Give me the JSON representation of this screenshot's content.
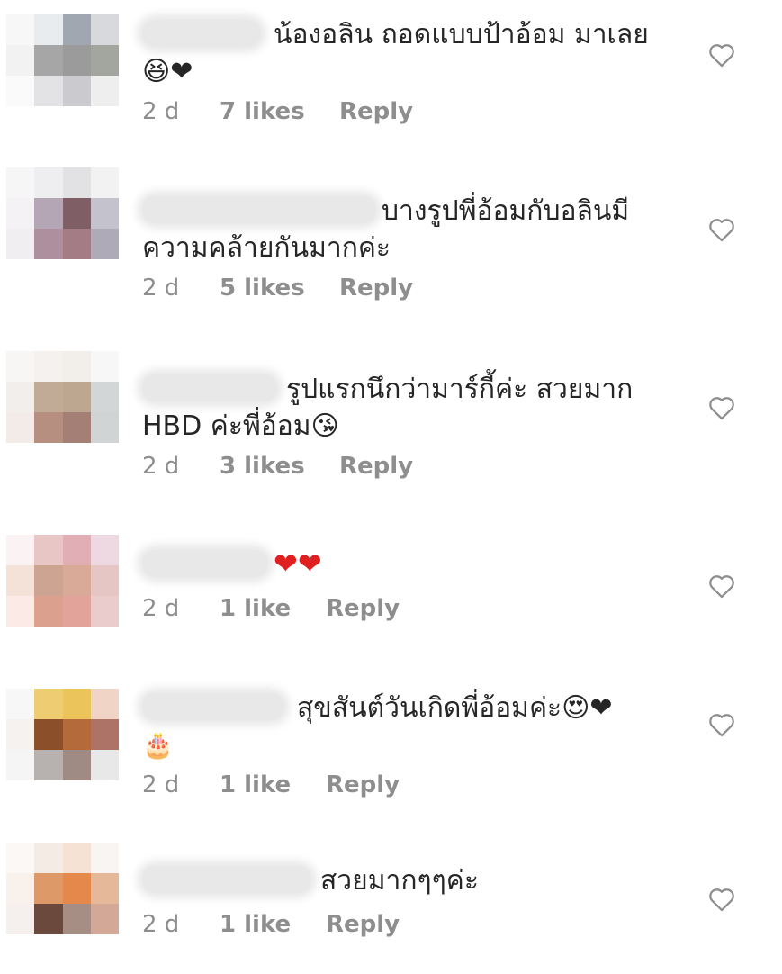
{
  "comments": [
    {
      "text_line1": "น้องอลิน ถอดแบบป้าอ้อม มาเลย",
      "text_line2": "😆❤",
      "time": "2 d",
      "likes": "7 likes",
      "reply": "Reply"
    },
    {
      "text_line1": "บางรูปพี่อ้อมกับอลินมี",
      "text_line2": "ความคล้ายกันมากค่ะ",
      "time": "2 d",
      "likes": "5 likes",
      "reply": "Reply"
    },
    {
      "text_line1": "รูปแรกนึกว่ามาร์กี้ค่ะ สวยมาก",
      "text_line2": "HBD ค่ะพี่อ้อม😘",
      "time": "2 d",
      "likes": "3 likes",
      "reply": "Reply"
    },
    {
      "text_line1": "❤❤",
      "time": "2 d",
      "likes": "1 like",
      "reply": "Reply"
    },
    {
      "text_line1": "สุขสันต์วันเกิดพี่อ้อมค่ะ😍❤",
      "text_line2": "🎂",
      "time": "2 d",
      "likes": "1 like",
      "reply": "Reply"
    },
    {
      "text_line1": "สวยมากๆๆค่ะ",
      "time": "2 d",
      "likes": "1 like",
      "reply": "Reply"
    }
  ],
  "icons": {
    "like": "heart-outline-icon"
  },
  "colors": {
    "text": "#262626",
    "meta": "#8e8e8e",
    "heart_outline": "#8e8e8e"
  }
}
